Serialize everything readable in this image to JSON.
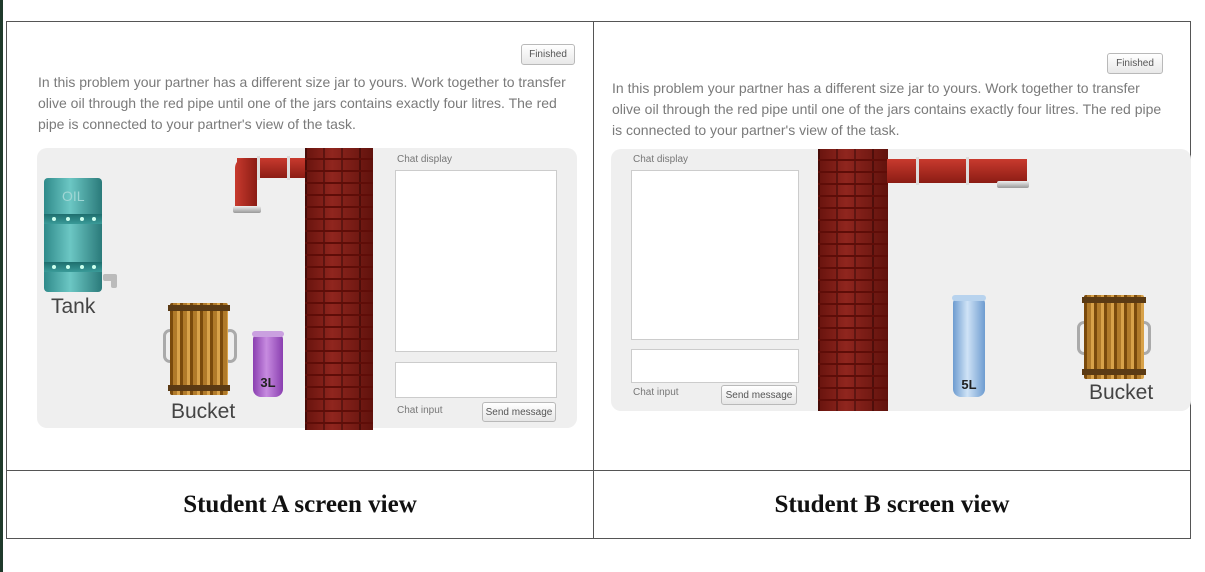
{
  "panels": {
    "a": {
      "finished_label": "Finished",
      "instructions": "In this problem your partner has a different size jar to yours. Work together to transfer olive oil through the red pipe until one of the jars contains exactly four litres. The red pipe is connected to your partner's view of the task.",
      "chat_display_label": "Chat display",
      "chat_input_label": "Chat input",
      "send_label": "Send message",
      "tank_label": "Tank",
      "tank_text": "OIL",
      "bucket_label": "Bucket",
      "jar_label": "3L",
      "jar_color": "#a95cc8",
      "caption": "Student A screen view"
    },
    "b": {
      "finished_label": "Finished",
      "instructions": "In this problem your partner has a different size jar to yours. Work together to transfer olive oil through the red pipe until one of the jars contains exactly four litres. The red pipe is connected to your partner's view of the task.",
      "chat_display_label": "Chat display",
      "chat_input_label": "Chat input",
      "send_label": "Send message",
      "bucket_label": "Bucket",
      "jar_label": "5L",
      "jar_color": "#8fb8e0",
      "caption": "Student B screen view"
    }
  },
  "colors": {
    "pipe": "#b02a20",
    "brick": "#8a1a12",
    "tank": "#3aa0a0"
  }
}
